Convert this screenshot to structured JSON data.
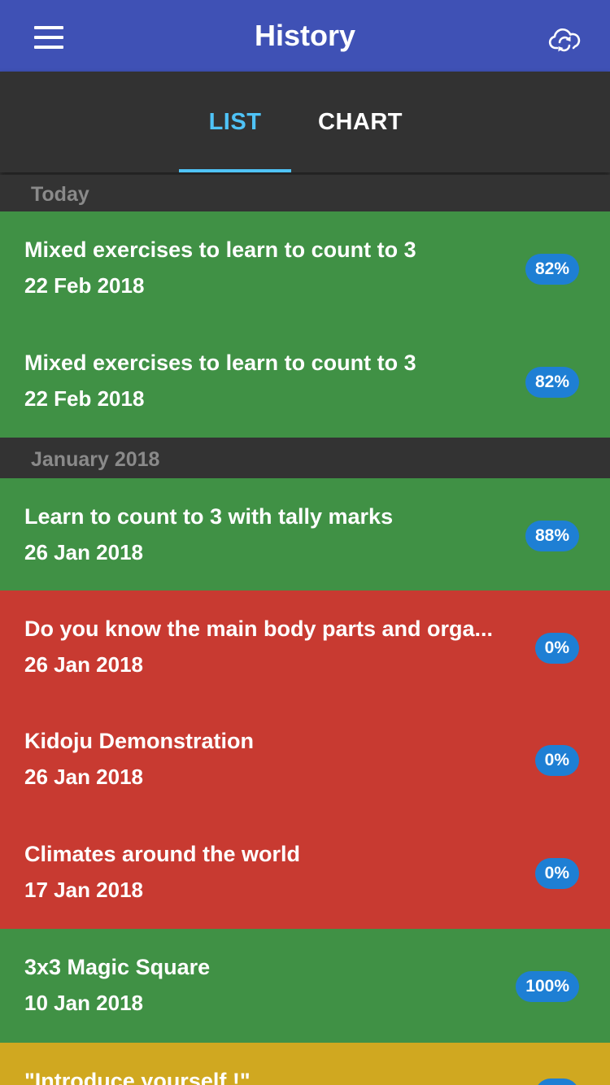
{
  "header": {
    "title": "History",
    "menu_icon": "hamburger-menu-icon",
    "sync_icon": "cloud-sync-icon"
  },
  "tabs": [
    {
      "label": "LIST",
      "active": true
    },
    {
      "label": "CHART",
      "active": false
    }
  ],
  "colors": {
    "appbar": "#3f51b5",
    "accent": "#4fc3f7",
    "pass": "#409145",
    "fail": "#c83a31",
    "medium": "#d0a820",
    "badge": "#1e7fd4"
  },
  "sections": [
    {
      "header": "Today"
    },
    {
      "header": "January 2018"
    }
  ],
  "items": [
    {
      "title": "Mixed exercises to learn to count to 3",
      "date": "22 Feb 2018",
      "score": "82%",
      "status": "pass"
    },
    {
      "title": "Mixed exercises to learn to count to 3",
      "date": "22 Feb 2018",
      "score": "82%",
      "status": "pass"
    },
    {
      "title": "Learn to count to 3 with tally marks",
      "date": "26 Jan 2018",
      "score": "88%",
      "status": "pass"
    },
    {
      "title": "Do you know the main body parts and orga...",
      "date": "26 Jan 2018",
      "score": "0%",
      "status": "fail"
    },
    {
      "title": "Kidoju Demonstration",
      "date": "26 Jan 2018",
      "score": "0%",
      "status": "fail"
    },
    {
      "title": "Climates around the world",
      "date": "17 Jan 2018",
      "score": "0%",
      "status": "fail"
    },
    {
      "title": "3x3 Magic Square",
      "date": "10 Jan 2018",
      "score": "100%",
      "status": "pass"
    },
    {
      "title": "\"Introduce yourself !\"",
      "date": "",
      "score": "",
      "status": "medium"
    }
  ]
}
